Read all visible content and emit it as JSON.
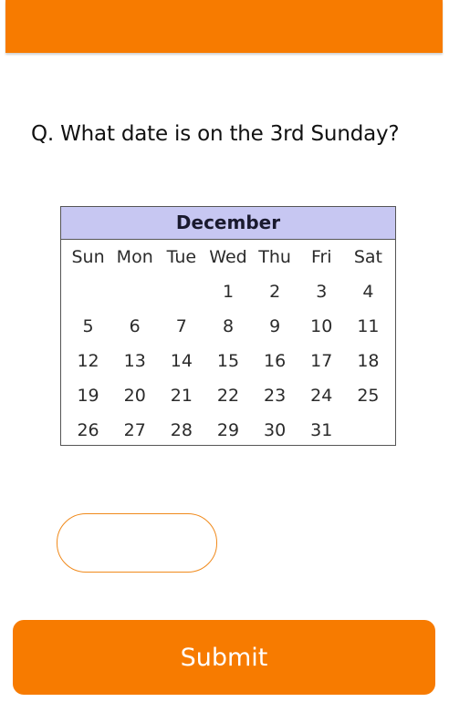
{
  "question": "Q. What date is on the 3rd Sunday?",
  "calendar": {
    "month": "December",
    "weekdays": [
      "Sun",
      "Mon",
      "Tue",
      "Wed",
      "Thu",
      "Fri",
      "Sat"
    ],
    "weeks": [
      [
        "",
        "",
        "",
        "1",
        "2",
        "3",
        "4"
      ],
      [
        "5",
        "6",
        "7",
        "8",
        "9",
        "10",
        "11"
      ],
      [
        "12",
        "13",
        "14",
        "15",
        "16",
        "17",
        "18"
      ],
      [
        "19",
        "20",
        "21",
        "22",
        "23",
        "24",
        "25"
      ],
      [
        "26",
        "27",
        "28",
        "29",
        "30",
        "31",
        ""
      ]
    ]
  },
  "answer": {
    "value": "",
    "placeholder": ""
  },
  "submit_label": "Submit",
  "colors": {
    "accent": "#f77b00",
    "calendar_header": "#c7c7f2"
  }
}
